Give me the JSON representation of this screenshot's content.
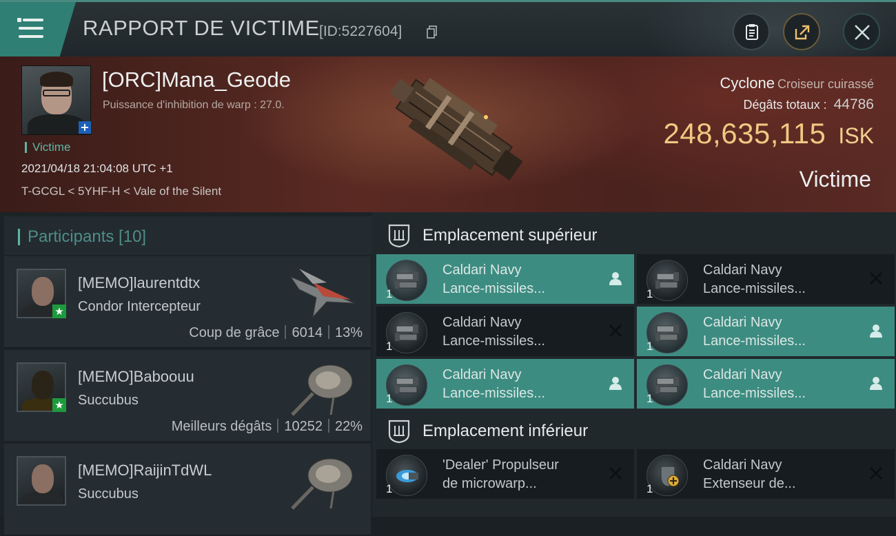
{
  "header": {
    "title": "RAPPORT DE VICTIME",
    "id_label": "[ID:5227604]"
  },
  "victim": {
    "name": "[ORC]Mana_Geode",
    "subtitle": "Puissance d'inhibition de warp : 27.0.",
    "role": "Victime",
    "datetime": "2021/04/18 21:04:08 UTC +1",
    "location": "T-GCGL < 5YHF-H < Vale of the Silent",
    "ship": "Cyclone",
    "ship_class": "Croiseur cuirassé",
    "damage_label": "Dégâts totaux :",
    "damage_value": "44786",
    "isk_value": "248,635,115",
    "isk_unit": "ISK",
    "status": "Victime"
  },
  "participants": {
    "title": "Participants [10]",
    "rows": [
      {
        "name": "[MEMO]laurentdtx",
        "ship": "Condor Intercepteur",
        "stat_label": "Coup de grâce",
        "damage": "6014",
        "percent": "13%"
      },
      {
        "name": "[MEMO]Baboouu",
        "ship": "Succubus",
        "stat_label": "Meilleurs dégâts",
        "damage": "10252",
        "percent": "22%"
      },
      {
        "name": "[MEMO]RaijinTdWL",
        "ship": "Succubus",
        "stat_label": "",
        "damage": "",
        "percent": ""
      }
    ]
  },
  "slots": {
    "high_title": "Emplacement supérieur",
    "high": [
      {
        "line1": "Caldari Navy",
        "line2": "Lance-missiles...",
        "qty": "1",
        "state": "pilot"
      },
      {
        "line1": "Caldari Navy",
        "line2": "Lance-missiles...",
        "qty": "1",
        "state": "destroyed"
      },
      {
        "line1": "Caldari Navy",
        "line2": "Lance-missiles...",
        "qty": "1",
        "state": "destroyed"
      },
      {
        "line1": "Caldari Navy",
        "line2": "Lance-missiles...",
        "qty": "1",
        "state": "pilot"
      },
      {
        "line1": "Caldari Navy",
        "line2": "Lance-missiles...",
        "qty": "1",
        "state": "pilot"
      },
      {
        "line1": "Caldari Navy",
        "line2": "Lance-missiles...",
        "qty": "1",
        "state": "pilot"
      }
    ],
    "low_title": "Emplacement inférieur",
    "low": [
      {
        "line1": "'Dealer' Propulseur",
        "line2": "de microwarp...",
        "qty": "1",
        "state": "destroyed"
      },
      {
        "line1": "Caldari Navy",
        "line2": "Extenseur de...",
        "qty": "1",
        "state": "destroyed"
      }
    ]
  },
  "colors": {
    "accent": "#3d8c81",
    "isk": "#f0c883",
    "badge_corp": "#1e9a3e",
    "badge_victim": "#1c5fb8"
  }
}
